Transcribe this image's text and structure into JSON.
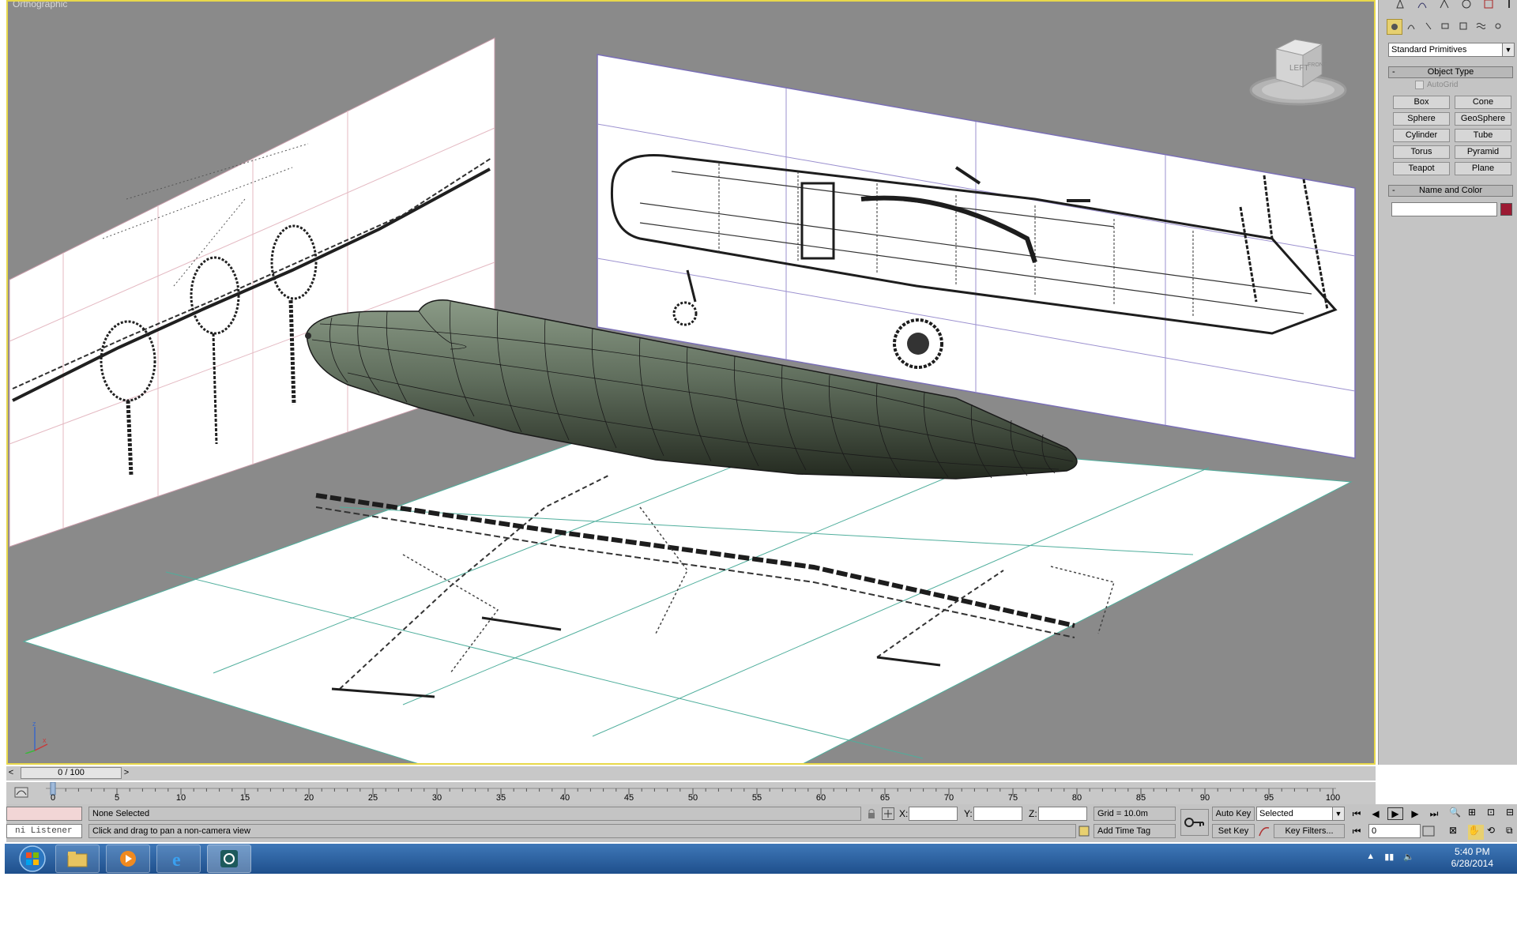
{
  "viewport": {
    "label": "Orthographic",
    "viewcube_front": "LEFT",
    "viewcube_side": "FRONT",
    "axis_z": "z",
    "axis_x": "x"
  },
  "command_panel": {
    "category_dropdown": "Standard Primitives",
    "object_type_title": "Object Type",
    "rollout_minus": "-",
    "autogrid_label": "AutoGrid",
    "buttons": [
      "Box",
      "Cone",
      "Sphere",
      "GeoSphere",
      "Cylinder",
      "Tube",
      "Torus",
      "Pyramid",
      "Teapot",
      "Plane"
    ],
    "name_color_title": "Name and Color",
    "object_color": "#9c1a33"
  },
  "timeslider": {
    "position": "0 / 100",
    "prev": "<",
    "next": ">"
  },
  "timeline": {
    "ticks": [
      "0",
      "5",
      "10",
      "15",
      "20",
      "25",
      "30",
      "35",
      "40",
      "45",
      "50",
      "55",
      "60",
      "65",
      "70",
      "75",
      "80",
      "85",
      "90",
      "95",
      "100"
    ]
  },
  "statusbar": {
    "selection": "None Selected",
    "prompt": "Click and drag to pan a non-camera view",
    "listener": "ni Listener",
    "x_label": "X:",
    "y_label": "Y:",
    "z_label": "Z:",
    "x_value": "",
    "y_value": "",
    "z_value": "",
    "grid": "Grid = 10.0m",
    "add_time_tag": "Add Time Tag",
    "auto_key": "Auto Key",
    "selected_dropdown": "Selected",
    "set_key": "Set Key",
    "key_filters": "Key Filters...",
    "frame": "0"
  },
  "taskbar": {
    "time": "5:40 PM",
    "date": "6/28/2014"
  },
  "colors": {
    "viewport_bg": "#8a8a8a",
    "active_border": "#e8d84a",
    "mesh": "#5e6b5c",
    "taskbar": "#2a5e9c"
  }
}
